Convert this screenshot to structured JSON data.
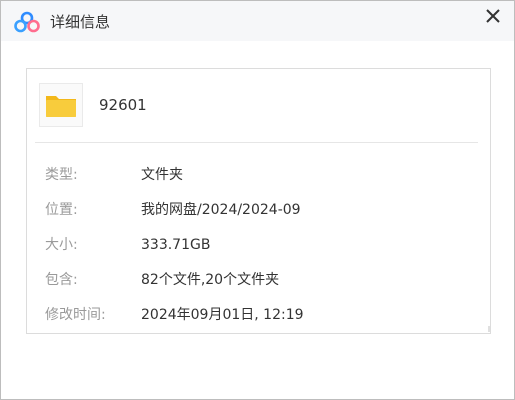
{
  "window": {
    "title": "详细信息",
    "app_icon": "baidu-netdisk-cloud-icon",
    "close_icon": "close-icon"
  },
  "item": {
    "icon": "folder-icon",
    "icon_color": "#f5c518",
    "name": "92601"
  },
  "details": [
    {
      "label": "类型:",
      "value": "文件夹"
    },
    {
      "label": "位置:",
      "value": "我的网盘/2024/2024-09"
    },
    {
      "label": "大小:",
      "value": "333.71GB"
    },
    {
      "label": "包含:",
      "value": "82个文件,20个文件夹"
    },
    {
      "label": "修改时间:",
      "value": "2024年09月01日, 12:19"
    }
  ],
  "colors": {
    "title_bar_bg": "#f6f7f9",
    "label_text": "#9a9a9a",
    "value_text": "#333333",
    "logo_blue": "#2f8cff",
    "logo_pink": "#ff6d8f"
  }
}
